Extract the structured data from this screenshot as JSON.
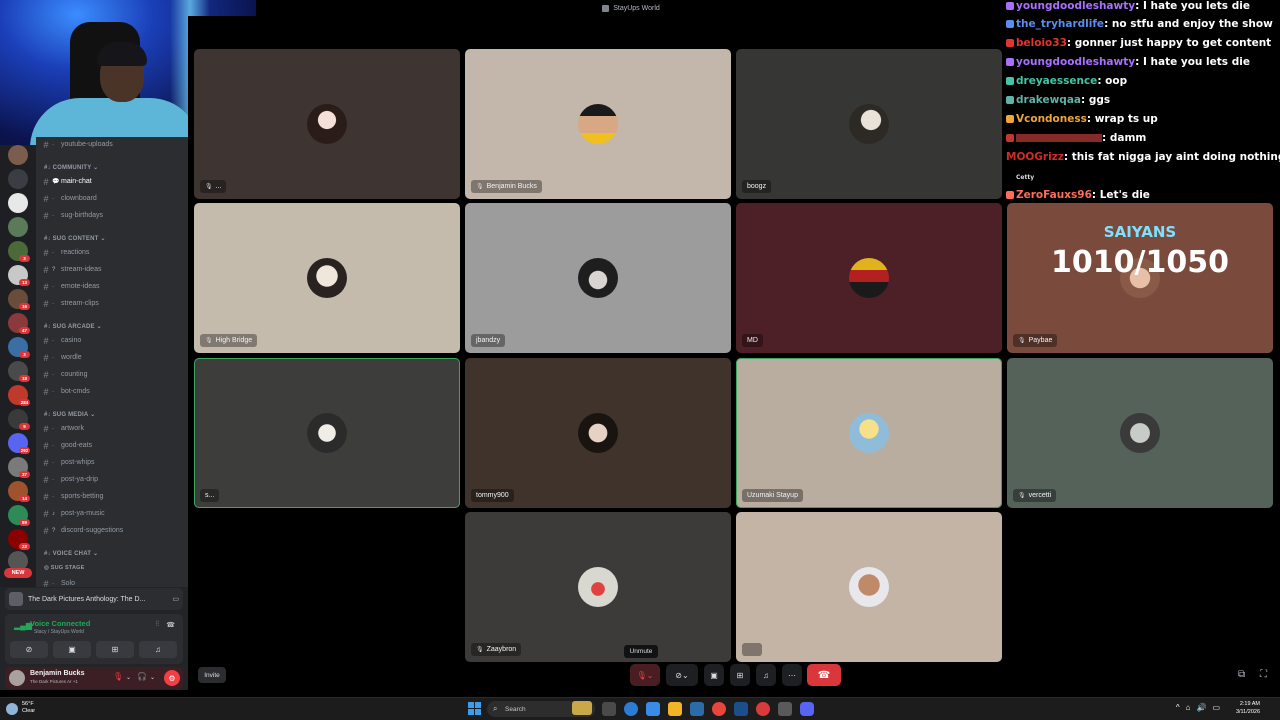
{
  "window": {
    "title": "StayUps World"
  },
  "server_rail": {
    "new_badge": "NEW",
    "badges": [
      "3",
      "13",
      "16",
      "47",
      "3",
      "18",
      "284",
      "9",
      "292",
      "37",
      "14",
      "89",
      "22"
    ]
  },
  "channels": {
    "categories": {
      "community": "COMMUNITY",
      "sug_content": "SUG CONTENT",
      "sug_arcade": "SUG ARCADE",
      "sug_media": "SUG MEDIA",
      "voice_chat": "VOICE CHAT",
      "sug_stage": "SUG STAGE"
    },
    "items": {
      "youtube_uploads": "youtube-uploads",
      "main_chat": "main-chat",
      "clownboard": "clownboard",
      "sug_birthdays": "sug-birthdays",
      "reactions": "reactions",
      "stream_ideas": "stream-ideas",
      "emote_ideas": "emote-ideas",
      "stream_clips": "stream-clips",
      "casino": "casino",
      "wordle": "wordle",
      "counting": "counting",
      "bot_cmds": "bot-cmds",
      "artwork": "artwork",
      "good_eats": "good-eats",
      "post_whips": "post-whips",
      "post_ya_drip": "post-ya-drip",
      "sports_betting": "sports-betting",
      "post_ya_music": "post-ya-music",
      "discord_suggestions": "discord-suggestions",
      "solo": "Solo"
    }
  },
  "activity": {
    "label": "The Dark Pictures Anthology: The D..."
  },
  "voice": {
    "status": "Voice Connected",
    "location": "Stacy / StayUps World"
  },
  "user": {
    "name": "Benjamin Bucks",
    "status": "The Dark Pictures Ar +1"
  },
  "tiles": [
    {
      "name": "...",
      "bg": "#3e3533"
    },
    {
      "name": "Benjamin Bucks",
      "bg": "#c3b6aa"
    },
    {
      "name": "boogz",
      "bg": "#363634"
    },
    {
      "name": "High Bridge",
      "bg": "#c5bbac"
    },
    {
      "name": "jbandzy",
      "bg": "#9c9c9c"
    },
    {
      "name": "MD",
      "bg": "#4d1f27"
    },
    {
      "name": "Paybae",
      "bg": "#7a4a3c"
    },
    {
      "name": "s...",
      "bg": "#3d3e3c"
    },
    {
      "name": "tommy900",
      "bg": "#3f332b"
    },
    {
      "name": "Uzumaki Stayup",
      "bg": "#b8ad9f"
    },
    {
      "name": "vercetti",
      "bg": "#55625a"
    },
    {
      "name": "Zaaybron",
      "bg": "#3c3b3a"
    },
    {
      "name": "",
      "bg": "#c4b4a6"
    }
  ],
  "overlay": {
    "title": "SAIYANS",
    "count": "1010/1050",
    "cetty": "Cetty"
  },
  "chat": [
    {
      "user": "youngdoodleshawty",
      "color": "#a970ff",
      "msg": ": I hate you lets die"
    },
    {
      "user": "the_tryhardlife",
      "color": "#5b8def",
      "msg": ": no stfu and enjoy the show"
    },
    {
      "user": "beloio33",
      "color": "#e3352c",
      "msg": ": gonner just happy to get content"
    },
    {
      "user": "youngdoodleshawty",
      "color": "#a970ff",
      "msg": ": I hate you lets die"
    },
    {
      "user": "dreyaessence",
      "color": "#43c6a5",
      "msg": ": oop"
    },
    {
      "user": "drakewqaa",
      "color": "#5fb3a6",
      "msg": ": ggs"
    },
    {
      "user": "Vcondoness",
      "color": "#f0a53a",
      "msg": ": wrap ts up"
    },
    {
      "user": "",
      "color": "#c0392b",
      "msg": ": damm"
    },
    {
      "user": "MOOGrizz",
      "color": "#d42a2a",
      "msg": ": this fat nigga jay aint doing nothing"
    },
    {
      "user": "ZeroFauxs96",
      "color": "#ff6d5a",
      "msg": ": Let's die"
    }
  ],
  "controls": {
    "unmute_tooltip": "Unmute",
    "invite": "Invite"
  },
  "taskbar": {
    "weather_temp": "56°F",
    "weather_desc": "Clear",
    "search": "Search",
    "time": "2:19 AM",
    "date": "3/11/2026"
  }
}
